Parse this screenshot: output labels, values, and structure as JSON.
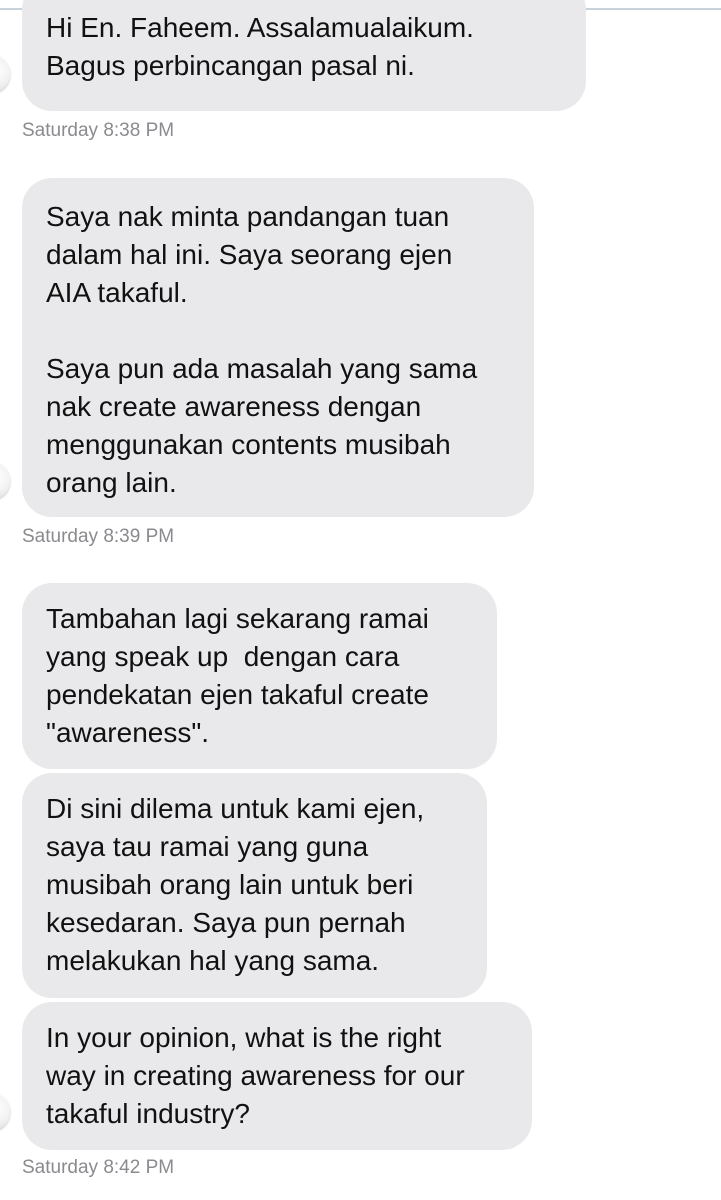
{
  "messages": [
    {
      "text": "Hi En. Faheem. Assalamualaikum.\nBagus perbincangan pasal ni.",
      "timestamp": "Saturday 8:38 PM"
    },
    {
      "text": "Saya nak minta pandangan tuan\ndalam hal ini. Saya seorang ejen\nAIA takaful.\n\nSaya pun ada masalah yang sama\nnak create awareness dengan\nmenggunakan contents musibah\norang lain.",
      "timestamp": "Saturday 8:39 PM"
    },
    {
      "text": "Tambahan lagi sekarang ramai\nyang speak up  dengan cara\npendekatan ejen takaful create\n\"awareness\"."
    },
    {
      "text": "Di sini dilema untuk kami ejen,\nsaya tau ramai yang guna\nmusibah orang lain untuk beri\nkesedaran. Saya pun pernah\nmelakukan hal yang sama."
    },
    {
      "text": "In your opinion, what is the right\nway in creating awareness for our\ntakaful industry?",
      "timestamp": "Saturday 8:42 PM"
    }
  ],
  "colors": {
    "bubble_background": "#e9e9eb",
    "message_text": "#111111",
    "timestamp_text": "#8a8a8f",
    "page_background": "#ffffff"
  },
  "icons": {
    "avatar": "sender-avatar-icon"
  }
}
